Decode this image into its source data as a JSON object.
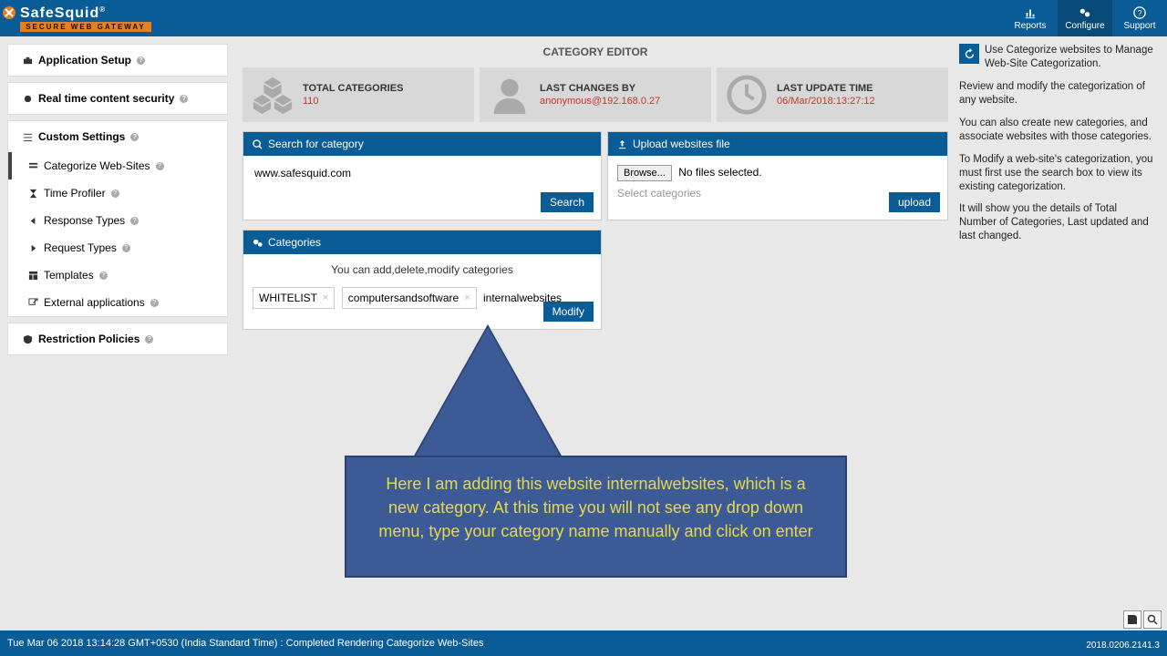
{
  "brand": {
    "name": "SafeSquid",
    "reg": "®",
    "tag": "SECURE WEB GATEWAY"
  },
  "topnav": {
    "reports": "Reports",
    "configure": "Configure",
    "support": "Support"
  },
  "sidebar": {
    "app_setup": "Application Setup",
    "realtime": "Real time content security",
    "custom": "Custom Settings",
    "items": [
      "Categorize Web-Sites",
      "Time Profiler",
      "Response Types",
      "Request Types",
      "Templates",
      "External applications"
    ],
    "restriction": "Restriction Policies"
  },
  "page": {
    "title": "CATEGORY EDITOR"
  },
  "stats": {
    "total_label": "TOTAL CATEGORIES",
    "total_value": "110",
    "changes_label": "LAST CHANGES BY",
    "changes_value": "anonymous@192.168.0.27",
    "update_label": "LAST UPDATE TIME",
    "update_value": "06/Mar/2018:13:27:12"
  },
  "search": {
    "title": "Search for category",
    "value": "www.safesquid.com",
    "btn": "Search"
  },
  "upload": {
    "title": "Upload websites file",
    "browse": "Browse...",
    "nofile": "No files selected.",
    "select": "Select categories",
    "btn": "upload"
  },
  "cats": {
    "title": "Categories",
    "note": "You can add,delete,modify categories",
    "tag1": "WHITELIST",
    "tag2": "computersandsoftware",
    "input": "internalwebsites",
    "btn": "Modify"
  },
  "help": {
    "p1": "Use Categorize websites to Manage Web-Site Categorization.",
    "p2": "Review and modify the categorization of any website.",
    "p3": "You can also create new categories, and associate websites with those categories.",
    "p4": "To Modify a web-site's categorization, you must first use the search box to view its existing categorization.",
    "p5": "It will show you the details of Total Number of Categories, Last updated and last changed."
  },
  "callout": "Here I am adding this website internalwebsites, which is a new category. At this time you will not see any drop down menu, type your category name manually and click on enter",
  "footer": {
    "status": "Tue Mar 06 2018 13:14:28 GMT+0530 (India Standard Time) : Completed Rendering Categorize Web-Sites",
    "version": "2018.0206.2141.3"
  }
}
